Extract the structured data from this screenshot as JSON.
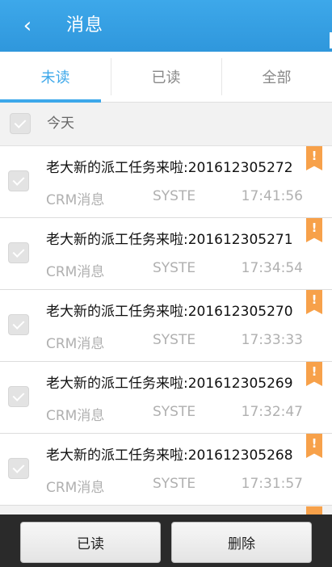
{
  "header": {
    "back_icon": "chevron-left-icon",
    "title": "消息"
  },
  "tabs": [
    {
      "label": "未读",
      "active": true
    },
    {
      "label": "已读",
      "active": false
    },
    {
      "label": "全部",
      "active": false
    }
  ],
  "section": {
    "label": "今天"
  },
  "messages": [
    {
      "title": "老大新的派工任务来啦:201612305272",
      "source": "CRM消息",
      "sender": "SYSTE",
      "time": "17:41:56"
    },
    {
      "title": "老大新的派工任务来啦:201612305271",
      "source": "CRM消息",
      "sender": "SYSTE",
      "time": "17:34:54"
    },
    {
      "title": "老大新的派工任务来啦:201612305270",
      "source": "CRM消息",
      "sender": "SYSTE",
      "time": "17:33:33"
    },
    {
      "title": "老大新的派工任务来啦:201612305269",
      "source": "CRM消息",
      "sender": "SYSTE",
      "time": "17:32:47"
    },
    {
      "title": "老大新的派工任务来啦:201612305268",
      "source": "CRM消息",
      "sender": "SYSTE",
      "time": "17:31:57"
    }
  ],
  "flag_symbol": "!",
  "flag_color": "#f7a14a",
  "accent_color": "#3da8ea",
  "bottom_bar": {
    "read_label": "已读",
    "delete_label": "删除"
  }
}
